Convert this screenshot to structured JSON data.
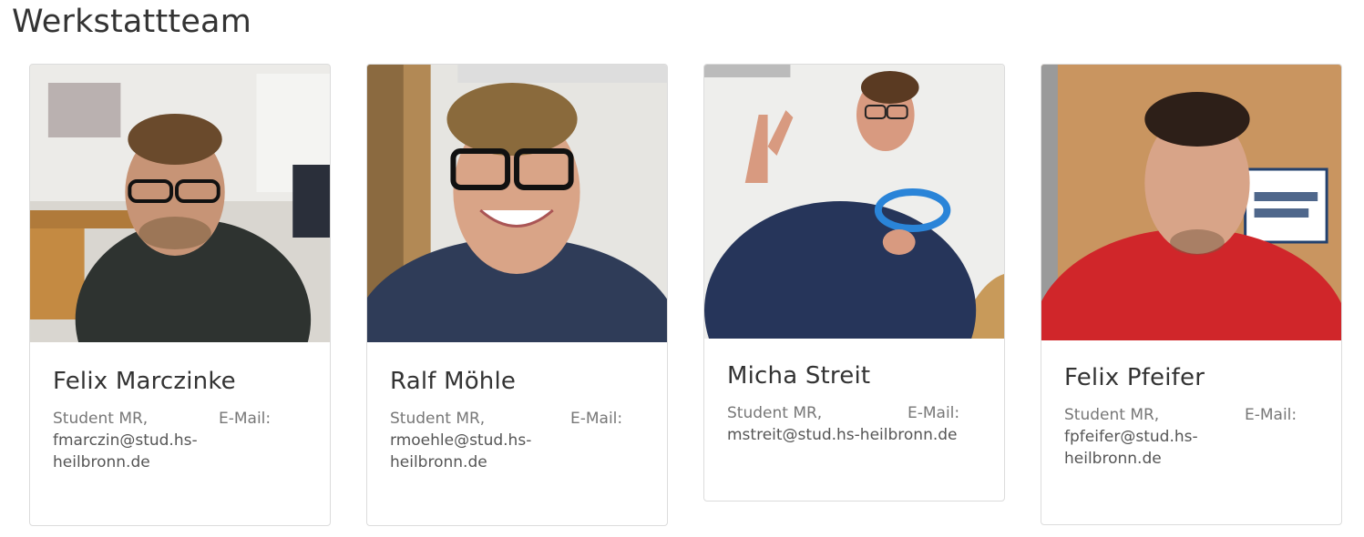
{
  "section": {
    "title": "Werkstattteam"
  },
  "members": [
    {
      "name": "Felix Marczinke",
      "role": "Student MR,",
      "mail_label": "E-Mail:",
      "email_line1": "fmarczin@stud.hs-",
      "email_line2": "heilbronn.de",
      "photo_icon": "person-photo"
    },
    {
      "name": "Ralf Möhle",
      "role": "Student MR,",
      "mail_label": "E-Mail:",
      "email_line1": "rmoehle@stud.hs-",
      "email_line2": "heilbronn.de",
      "photo_icon": "person-photo"
    },
    {
      "name": "Micha Streit",
      "role": "Student MR,",
      "mail_label": "E-Mail:",
      "email_line1": "mstreit@stud.hs-heilbronn.de",
      "email_line2": "",
      "photo_icon": "person-photo"
    },
    {
      "name": "Felix Pfeifer",
      "role": "Student MR,",
      "mail_label": "E-Mail:",
      "email_line1": "fpfeifer@stud.hs-",
      "email_line2": "heilbronn.de",
      "photo_icon": "person-photo"
    }
  ],
  "colors": {
    "card_border": "#dcdcdc",
    "text_primary": "#333333",
    "text_secondary": "#777777"
  }
}
